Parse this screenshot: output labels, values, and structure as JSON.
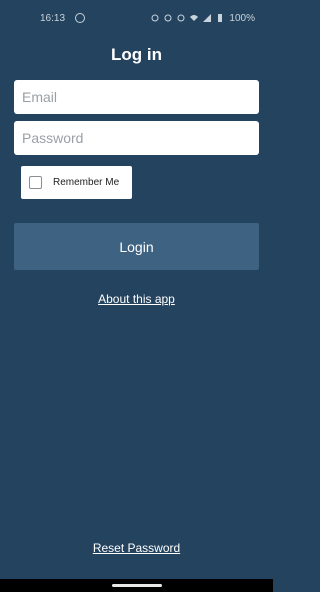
{
  "status_bar": {
    "time": "16:13",
    "battery": "100%"
  },
  "page": {
    "title": "Log in"
  },
  "form": {
    "email_placeholder": "Email",
    "password_placeholder": "Password",
    "remember_label": "Remember Me",
    "login_label": "Login"
  },
  "links": {
    "about": "About this app",
    "reset": "Reset Password"
  },
  "colors": {
    "background": "#24435f",
    "button": "#3e6282"
  }
}
